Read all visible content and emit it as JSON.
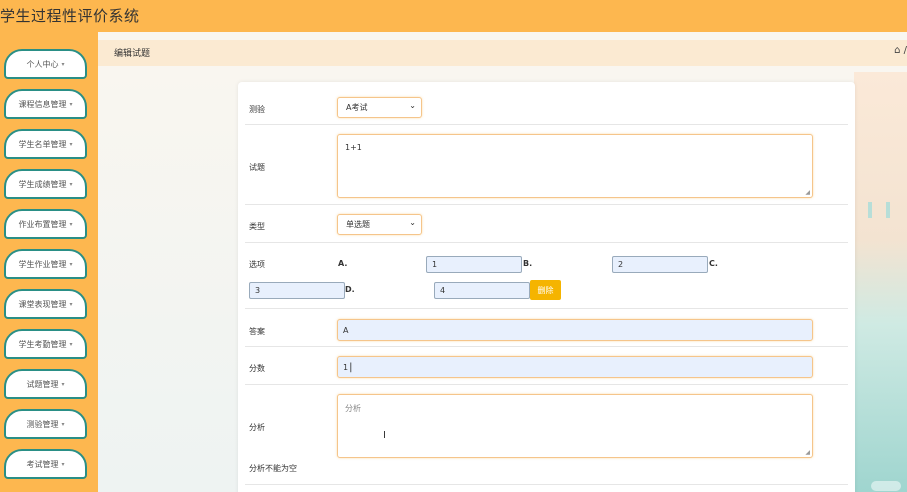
{
  "app": {
    "title": "学生过程性评价系统"
  },
  "sidebar": {
    "items": [
      {
        "label": "个人中心",
        "caret": "▾"
      },
      {
        "label": "课程信息管理",
        "caret": "▾"
      },
      {
        "label": "学生名单管理",
        "caret": "▾"
      },
      {
        "label": "学生成绩管理",
        "caret": "▾"
      },
      {
        "label": "作业布置管理",
        "caret": "▾"
      },
      {
        "label": "学生作业管理",
        "caret": "▾"
      },
      {
        "label": "课堂表现管理",
        "caret": "▾"
      },
      {
        "label": "学生考勤管理",
        "caret": "▾"
      },
      {
        "label": "试题管理",
        "caret": "▾"
      },
      {
        "label": "测验管理",
        "caret": "▾"
      },
      {
        "label": "考试管理",
        "caret": "▾"
      }
    ]
  },
  "breadcrumb": {
    "title": "编辑试题",
    "home": "⌂ /"
  },
  "form": {
    "exam": {
      "label": "测验",
      "value": "A考试",
      "arrow": "⌄"
    },
    "question": {
      "label": "试题",
      "value": "1+1"
    },
    "type": {
      "label": "类型",
      "value": "单选题",
      "arrow": "⌄"
    },
    "options": {
      "label": "选项",
      "letters": [
        "A.",
        "B.",
        "C.",
        "D."
      ],
      "values": [
        "1",
        "2",
        "3",
        "4"
      ],
      "delete_label": "删除"
    },
    "answer": {
      "label": "答案",
      "value": "A"
    },
    "score": {
      "label": "分数",
      "value": "1"
    },
    "analysis": {
      "label": "分析",
      "placeholder": "分析",
      "error": "分析不能为空"
    }
  },
  "colors": {
    "brand": "#fdb74f",
    "sidebar_border": "#2a8f86",
    "button": "#f5b400",
    "input_focus": "#f5c58b"
  }
}
